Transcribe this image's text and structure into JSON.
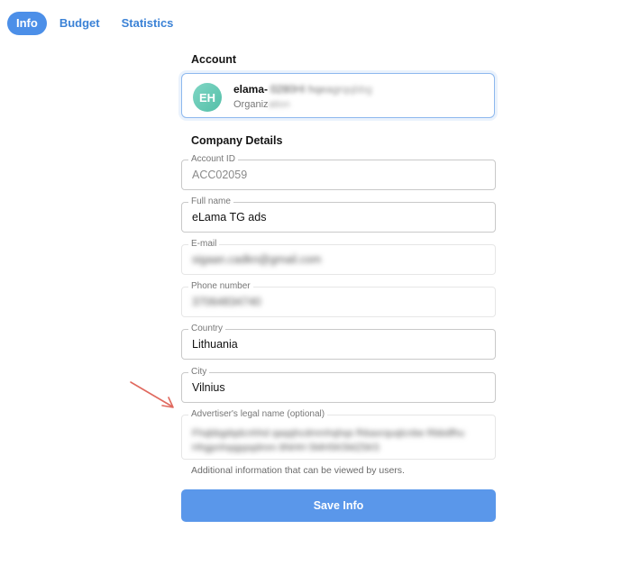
{
  "tabs": [
    {
      "label": "Info",
      "active": true
    },
    {
      "label": "Budget",
      "active": false
    },
    {
      "label": "Statistics",
      "active": false
    }
  ],
  "account": {
    "section_title": "Account",
    "avatar_initials": "EH",
    "name_visible": "elama-",
    "name_redacted": "0280HI hqeagrqqbbg",
    "subtitle_visible": "Organiz",
    "subtitle_redacted": "ation"
  },
  "company": {
    "section_title": "Company Details",
    "fields": {
      "account_id": {
        "label": "Account ID",
        "value": "ACC02059"
      },
      "full_name": {
        "label": "Full name",
        "value": "eLama TG ads"
      },
      "email": {
        "label": "E-mail",
        "value": "sigaan.cadkn@gmail.com"
      },
      "phone": {
        "label": "Phone number",
        "value": "37064834740"
      },
      "country": {
        "label": "Country",
        "value": "Lithuania"
      },
      "city": {
        "label": "City",
        "value": "Vilnius"
      },
      "legal_name": {
        "label": "Advertiser's legal name (optional)",
        "value": "Fhqbbgdqdcnhhd qaqqhcdmmhqhqs fhbaxrquqlcnbe Rbbdfhu Hhgpnhqqppqdmm 8NHH 5MH5K5MZ5K5"
      }
    },
    "helper_text": "Additional information that can be viewed by users."
  },
  "save_button": "Save Info",
  "colors": {
    "accent": "#4c8fe8",
    "button": "#5a97ea",
    "avatar": "#6ccbb6",
    "arrow": "#e0695e"
  }
}
